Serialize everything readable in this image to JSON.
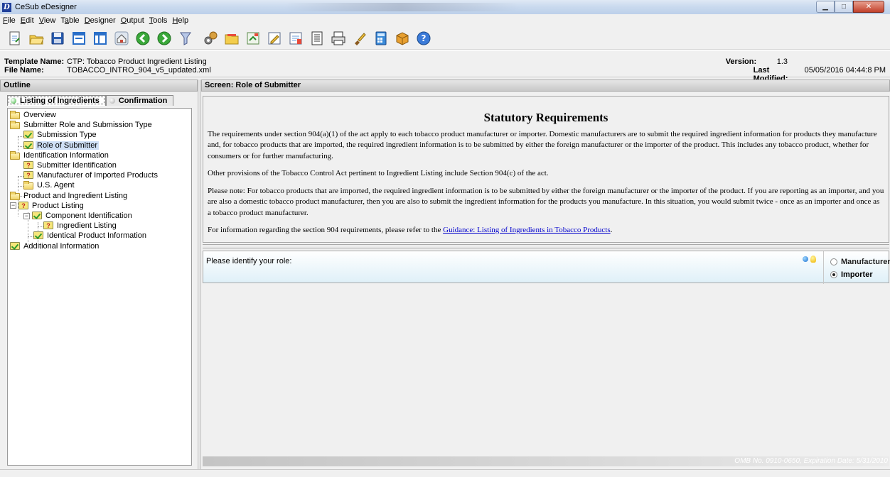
{
  "window": {
    "title": "CeSub eDesigner",
    "controls": {
      "minimize": "▁",
      "maximize": "□",
      "close": "✕"
    }
  },
  "menu": [
    {
      "label": "File",
      "mnemonic": "F"
    },
    {
      "label": "Edit",
      "mnemonic": "E"
    },
    {
      "label": "View",
      "mnemonic": "V"
    },
    {
      "label": "Table",
      "mnemonic": "a"
    },
    {
      "label": "Designer",
      "mnemonic": "D"
    },
    {
      "label": "Output",
      "mnemonic": "O"
    },
    {
      "label": "Tools",
      "mnemonic": "T"
    },
    {
      "label": "Help",
      "mnemonic": "H"
    }
  ],
  "toolbar": [
    "new-document-icon",
    "open-folder-icon",
    "save-icon",
    "window-icon",
    "panel-icon",
    "home-icon",
    "back-icon",
    "forward-icon",
    "filter-icon",
    "settings-icon",
    "folder-tab-icon",
    "export-icon",
    "edit-icon",
    "import-icon",
    "form-icon",
    "print-icon",
    "brush-icon",
    "calculator-icon",
    "package-icon",
    "help-icon"
  ],
  "info": {
    "template_label": "Template Name:",
    "template_value": "CTP: Tobacco Product Ingredient Listing",
    "file_label": "File Name:",
    "file_value": "TOBACCO_INTRO_904_v5_updated.xml",
    "version_label": "Version:",
    "version_value": "1.3",
    "modified_label": "Last Modified:",
    "modified_value": "05/05/2016 04:44:8 PM"
  },
  "outline": {
    "header": "Outline",
    "tabs": [
      {
        "label": "Listing of Ingredients",
        "active": true,
        "dot_color": "#3cb83c"
      },
      {
        "label": "Confirmation",
        "active": false,
        "dot_color": "#a8a8a8"
      }
    ],
    "tree": [
      {
        "label": "Overview",
        "icon": "folder-icon"
      },
      {
        "label": "Submitter Role and Submission Type",
        "icon": "folder-icon"
      },
      {
        "label": "Submission Type",
        "icon": "checked-icon"
      },
      {
        "label": "Role of Submitter",
        "icon": "checked-icon",
        "selected": true
      },
      {
        "label": "Identification Information",
        "icon": "folder-icon"
      },
      {
        "label": "Submitter Identification",
        "icon": "question-icon"
      },
      {
        "label": "Manufacturer of Imported Products",
        "icon": "question-icon"
      },
      {
        "label": "U.S. Agent",
        "icon": "folder-icon"
      },
      {
        "label": "Product and Ingredient Listing",
        "icon": "folder-icon"
      },
      {
        "label": "Product Listing",
        "icon": "question-icon",
        "expander": "⊟"
      },
      {
        "label": "Component Identification",
        "icon": "checked-icon",
        "expander": "⊟"
      },
      {
        "label": "Ingredient Listing",
        "icon": "question-icon"
      },
      {
        "label": "Identical Product Information",
        "icon": "checked-icon"
      },
      {
        "label": "Additional Information",
        "icon": "checked-icon"
      }
    ]
  },
  "screen": {
    "header": "Screen: Role of Submitter",
    "heading": "Statutory Requirements",
    "p1": "The requirements under section 904(a)(1) of the act apply to each tobacco product manufacturer or importer. Domestic manufacturers are to submit the required ingredient information for products they manufacture and, for tobacco products that are imported, the required ingredient information is to be submitted by either the foreign manufacturer or the importer of the product. This includes any tobacco product, whether for consumers or for further manufacturing.",
    "p2": "Other provisions of the Tobacco Control Act pertinent to Ingredient Listing include Section 904(c) of the act.",
    "p3": "Please note: For tobacco products that are imported, the required ingredient information is to be submitted by either the foreign manufacturer or the importer of the product. If you are reporting as an importer, and you are also a domestic tobacco product manufacturer, then you are also to submit the ingredient information for the products you manufacture. In this situation, you would submit twice - once as an importer and once as a tobacco product manufacturer.",
    "p4_prefix": "For information regarding the section 904 requirements, please refer to the ",
    "p4_link": "Guidance: Listing of Ingredients in Tobacco Products",
    "p4_suffix": ".",
    "role_prompt": "Please identify your role:",
    "options": [
      {
        "label": "Manufacturer",
        "selected": false
      },
      {
        "label": "Importer",
        "selected": true
      }
    ],
    "omb": "OMB No. 0910-0650, Expiration Date: 5/31/2010"
  }
}
